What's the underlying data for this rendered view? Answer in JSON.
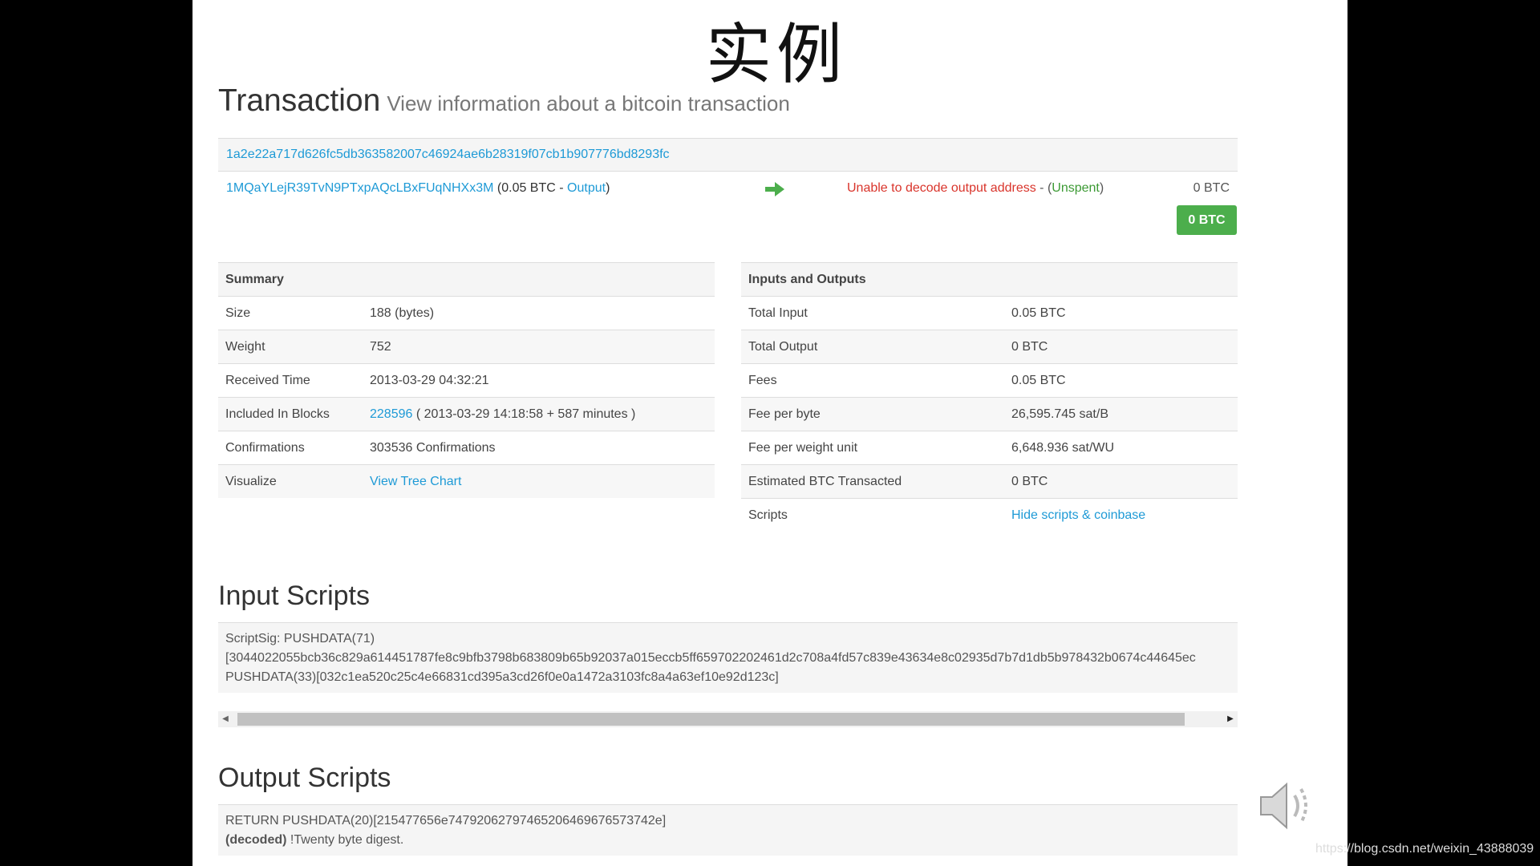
{
  "slide_title": "实例",
  "page": {
    "title": "Transaction",
    "subtitle": "View information about a bitcoin transaction"
  },
  "tx": {
    "hash": "1a2e22a717d626fc5db363582007c46924ae6b28319f07cb1b907776bd8293fc",
    "input_address": "1MQaYLejR39TvN9PTxpAQcLBxFUqNHXx3M",
    "input_amount_open": "(0.05 BTC - ",
    "input_output_link": "Output",
    "input_amount_close": ")",
    "output_address": "Unable to decode output address",
    "output_sep": " - (",
    "output_status": "Unspent",
    "output_close": ")",
    "output_amount": "0 BTC",
    "total_badge": "0 BTC"
  },
  "summary": {
    "header": "Summary",
    "size_label": "Size",
    "size_value": "188 (bytes)",
    "weight_label": "Weight",
    "weight_value": "752",
    "received_label": "Received Time",
    "received_value": "2013-03-29 04:32:21",
    "blocks_label": "Included In Blocks",
    "blocks_link": "228596",
    "blocks_rest": " ( 2013-03-29 14:18:58 + 587 minutes )",
    "confirm_label": "Confirmations",
    "confirm_value": "303536 Confirmations",
    "visualize_label": "Visualize",
    "visualize_link": "View Tree Chart"
  },
  "io": {
    "header": "Inputs and Outputs",
    "total_input_label": "Total Input",
    "total_input_value": "0.05 BTC",
    "total_output_label": "Total Output",
    "total_output_value": "0 BTC",
    "fees_label": "Fees",
    "fees_value": "0.05 BTC",
    "fee_byte_label": "Fee per byte",
    "fee_byte_value": "26,595.745 sat/B",
    "fee_wu_label": "Fee per weight unit",
    "fee_wu_value": "6,648.936 sat/WU",
    "est_label": "Estimated BTC Transacted",
    "est_value": "0 BTC",
    "scripts_label": "Scripts",
    "scripts_link": "Hide scripts & coinbase"
  },
  "input_scripts": {
    "title": "Input Scripts",
    "line1": "ScriptSig: PUSHDATA(71)",
    "line2": "[3044022055bcb36c829a614451787fe8c9bfb3798b683809b65b92037a015eccb5ff659702202461d2c708a4fd57c839e43634e8c02935d7b7d1db5b978432b0674c44645ec",
    "line3": "PUSHDATA(33)[032c1ea520c25c4e66831cd395a3cd26f0e0a1472a3103fc8a4a63ef10e92d123c]"
  },
  "output_scripts": {
    "title": "Output Scripts",
    "line1": "RETURN PUSHDATA(20)[215477656e74792062797465206469676573742e]",
    "decoded_label": "(decoded)",
    "decoded_text": " !Twenty byte digest."
  },
  "watermark": "https://blog.csdn.net/weixin_43888039",
  "colors": {
    "link": "#1e9ad6",
    "error": "#d9342b",
    "unspent": "#3c9a34",
    "badge": "#4cae4c"
  },
  "icons": {
    "arrow": "right-arrow-icon",
    "speaker": "speaker-icon"
  }
}
